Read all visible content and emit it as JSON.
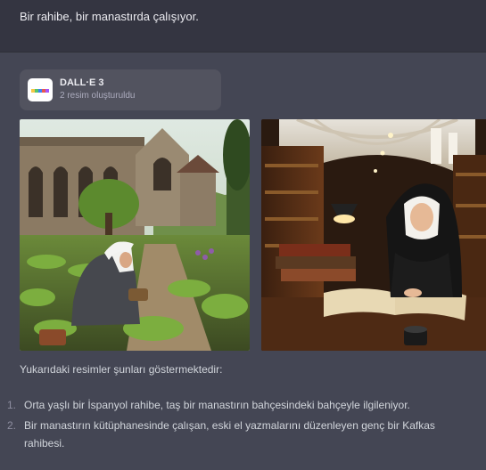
{
  "user_message": {
    "text": "Bir rahibe, bir manastırda çalışıyor."
  },
  "dalle_card": {
    "title": "DALL·E 3",
    "subtitle": "2 resim oluşturuldu",
    "logo_stripe_colors": [
      "#f7c948",
      "#57c46b",
      "#3b82f6",
      "#e8584d",
      "#a855f7"
    ]
  },
  "images": [
    {
      "name": "nun-garden-image",
      "icon": "image"
    },
    {
      "name": "nun-library-image",
      "icon": "image"
    }
  ],
  "response": {
    "intro": "Yukarıdaki resimler şunları göstermektedir:",
    "items": [
      {
        "num": "1.",
        "text": "Orta yaşlı bir İspanyol rahibe, taş bir manastırın bahçesindeki bahçeyle ilgileniyor."
      },
      {
        "num": "2.",
        "text": "Bir manastırın kütüphanesinde çalışan, eski el yazmalarını düzenleyen genç bir Kafkas rahibesi."
      }
    ]
  },
  "colors": {
    "user_bg": "#343541",
    "assistant_bg": "#444654",
    "card_bg": "#52535f",
    "text": "#ececf1"
  }
}
